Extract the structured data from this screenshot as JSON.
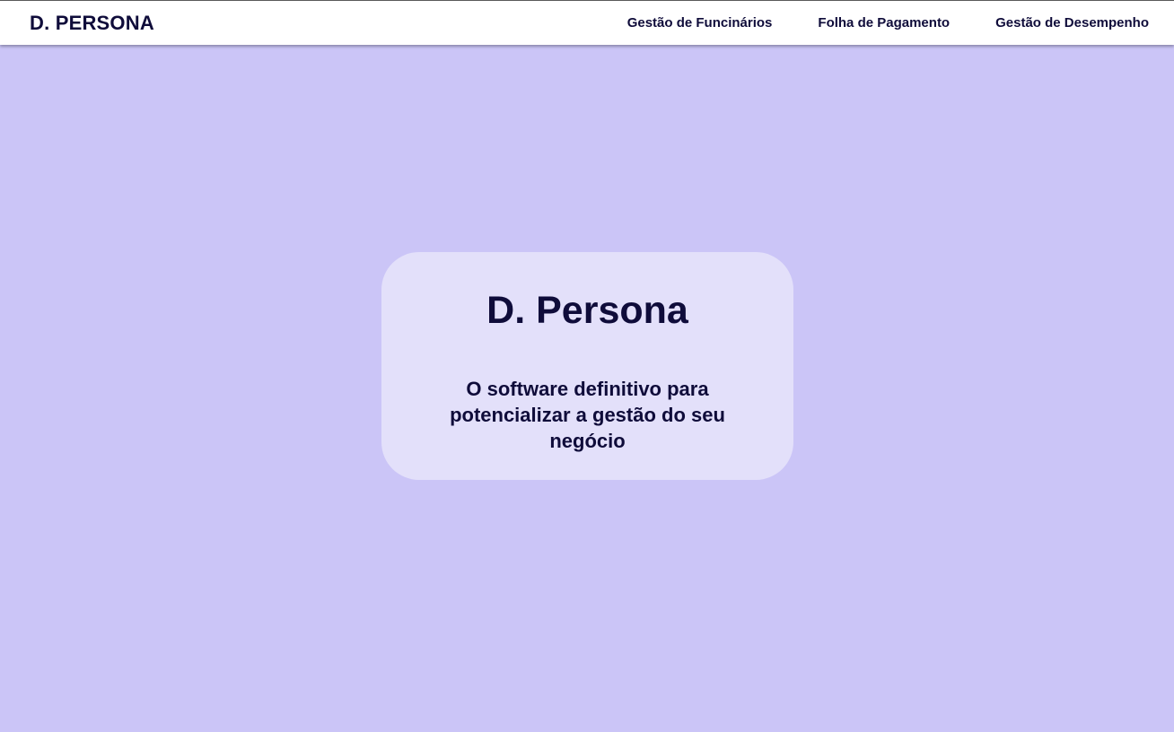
{
  "navbar": {
    "brand": "D. PERSONA",
    "links": [
      {
        "label": "Gestão de Funcinários"
      },
      {
        "label": "Folha de Pagamento"
      },
      {
        "label": "Gestão de Desempenho"
      }
    ]
  },
  "hero": {
    "title": "D. Persona",
    "subtitle": "O software definitivo para potencializar a gestão do seu negócio"
  },
  "colors": {
    "background": "#cbc5f7",
    "card": "#e3e0fa",
    "text": "#0f0c3a",
    "navbar": "#ffffff"
  }
}
